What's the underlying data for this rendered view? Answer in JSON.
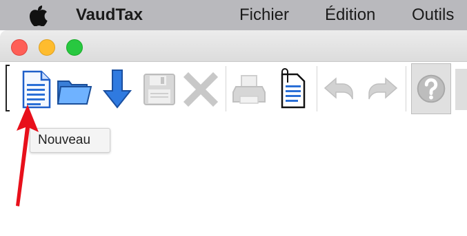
{
  "menubar": {
    "app_name": "VaudTax",
    "items": [
      {
        "label": "Fichier"
      },
      {
        "label": "Édition"
      },
      {
        "label": "Outils"
      }
    ]
  },
  "toolbar": {
    "buttons": [
      {
        "icon": "new-document-icon",
        "enabled": true
      },
      {
        "icon": "open-folder-icon",
        "enabled": true
      },
      {
        "icon": "download-arrow-icon",
        "enabled": true
      },
      {
        "icon": "save-floppy-icon",
        "enabled": false
      },
      {
        "icon": "delete-x-icon",
        "enabled": false
      },
      {
        "icon": "printer-icon",
        "enabled": false
      },
      {
        "icon": "attachment-document-icon",
        "enabled": true
      },
      {
        "icon": "undo-icon",
        "enabled": false
      },
      {
        "icon": "redo-icon",
        "enabled": false
      },
      {
        "icon": "help-icon",
        "enabled": true
      }
    ]
  },
  "tooltip": {
    "text": "Nouveau"
  },
  "colors": {
    "menubar": "#b9b9bd",
    "close": "#fe5f57",
    "minimize": "#febc2e",
    "maximize": "#28c840",
    "annotation_arrow": "#e8101b",
    "icon_blue": "#2a6fd6"
  }
}
